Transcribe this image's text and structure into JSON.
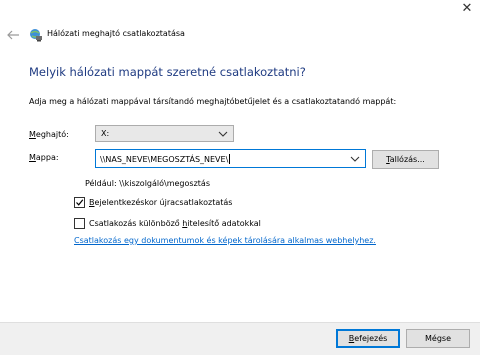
{
  "window": {
    "title": "Hálózati meghajtó csatlakoztatása",
    "close_glyph": "✕"
  },
  "icons": {
    "back": "back-arrow-icon",
    "network": "network-drive-icon",
    "close": "close-icon",
    "dropdown": "chevron-down-icon"
  },
  "main": {
    "heading": "Melyik hálózati mappát szeretné csatlakoztatni?",
    "instruction": "Adja meg a hálózati mappával társítandó meghajtóbetűjelet és a csatlakoztatandó mappát:",
    "drive": {
      "label_prefix": "M",
      "label_rest": "eghajtó:",
      "value": "X:"
    },
    "folder": {
      "label_prefix": "M",
      "label_rest": "appa:",
      "value": "\\\\NAS_NEVE\\MEGOSZTÁS_NEVE\\"
    },
    "browse_label_prefix": "T",
    "browse_label_rest": "allózás...",
    "example": "Például: \\\\kiszolgáló\\megosztás",
    "reconnect": {
      "checked": true,
      "label_prefix": "B",
      "label_rest": "ejelentkezéskor újracsatlakoztatás"
    },
    "credentials": {
      "checked": false,
      "label_before": "Csatlakozás különböző ",
      "label_ul": "h",
      "label_after": "itelesítő adatokkal"
    },
    "link": "Csatlakozás egy dokumentumok és képek tárolására alkalmas webhelyhez."
  },
  "footer": {
    "finish_prefix": "B",
    "finish_rest": "efejezés",
    "cancel": "Mégse"
  },
  "colors": {
    "heading": "#1f3b82",
    "accent": "#0078d7",
    "link": "#0066cc"
  }
}
